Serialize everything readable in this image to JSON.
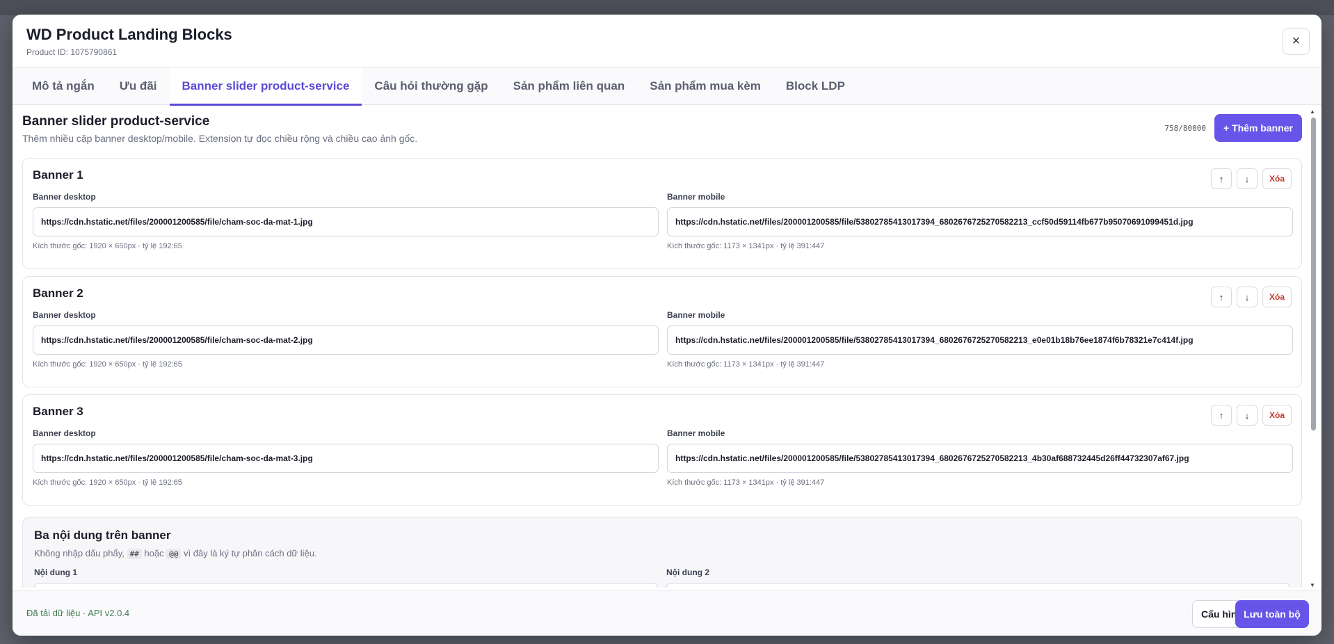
{
  "modal": {
    "title": "WD Product Landing Blocks",
    "subtitle": "Product ID: 1075790861",
    "close_icon": "×"
  },
  "tabs": [
    {
      "label": "Mô tả ngắn"
    },
    {
      "label": "Ưu đãi"
    },
    {
      "label": "Banner slider product-service",
      "active": true
    },
    {
      "label": "Câu hỏi thường gặp"
    },
    {
      "label": "Sản phẩm liên quan"
    },
    {
      "label": "Sản phẩm mua kèm"
    },
    {
      "label": "Block LDP"
    }
  ],
  "section": {
    "title": "Banner slider product-service",
    "description": "Thêm nhiều cặp banner desktop/mobile. Extension tự đọc chiều rộng và chiều cao ảnh gốc.",
    "counter": "758/80000",
    "add_button": "+ Thêm banner"
  },
  "banners": [
    {
      "title": "Banner 1",
      "desktop_label": "Banner desktop",
      "desktop_url": "https://cdn.hstatic.net/files/200001200585/file/cham-soc-da-mat-1.jpg",
      "desktop_hint": "Kích thước gốc: 1920 × 650px · tỷ lệ 192:65",
      "mobile_label": "Banner mobile",
      "mobile_url": "https://cdn.hstatic.net/files/200001200585/file/53802785413017394_6802676725270582213_ccf50d59114fb677b95070691099451d.jpg",
      "mobile_hint": "Kích thước gốc: 1173 × 1341px · tỷ lệ 391:447",
      "up": "↑",
      "down": "↓",
      "delete": "Xóa"
    },
    {
      "title": "Banner 2",
      "desktop_label": "Banner desktop",
      "desktop_url": "https://cdn.hstatic.net/files/200001200585/file/cham-soc-da-mat-2.jpg",
      "desktop_hint": "Kích thước gốc: 1920 × 650px · tỷ lệ 192:65",
      "mobile_label": "Banner mobile",
      "mobile_url": "https://cdn.hstatic.net/files/200001200585/file/53802785413017394_6802676725270582213_e0e01b18b76ee1874f6b78321e7c414f.jpg",
      "mobile_hint": "Kích thước gốc: 1173 × 1341px · tỷ lệ 391:447",
      "up": "↑",
      "down": "↓",
      "delete": "Xóa"
    },
    {
      "title": "Banner 3",
      "desktop_label": "Banner desktop",
      "desktop_url": "https://cdn.hstatic.net/files/200001200585/file/cham-soc-da-mat-3.jpg",
      "desktop_hint": "Kích thước gốc: 1920 × 650px · tỷ lệ 192:65",
      "mobile_label": "Banner mobile",
      "mobile_url": "https://cdn.hstatic.net/files/200001200585/file/53802785413017394_6802676725270582213_4b30af688732445d26ff44732307af67.jpg",
      "mobile_hint": "Kích thước gốc: 1173 × 1341px · tỷ lệ 391:447",
      "up": "↑",
      "down": "↓",
      "delete": "Xóa"
    }
  ],
  "content_block": {
    "title": "Ba nội dung trên banner",
    "desc_before": "Không nhập dấu phẩy, ",
    "code1": "##",
    "desc_mid": " hoặc ",
    "code2": "@@",
    "desc_after": " vì đây là ký tự phân cách dữ liệu.",
    "label1": "Nội dung 1",
    "label2": "Nội dung 2"
  },
  "footer": {
    "status": "Đã tải dữ liệu · API v2.0.4",
    "config_button": "Cấu hình",
    "save_button": "Lưu toàn bộ"
  },
  "colors": {
    "accent": "#6655e8",
    "active_tab": "#5b4bd6",
    "danger": "#c0392b",
    "status_ok": "#3f7a52"
  }
}
